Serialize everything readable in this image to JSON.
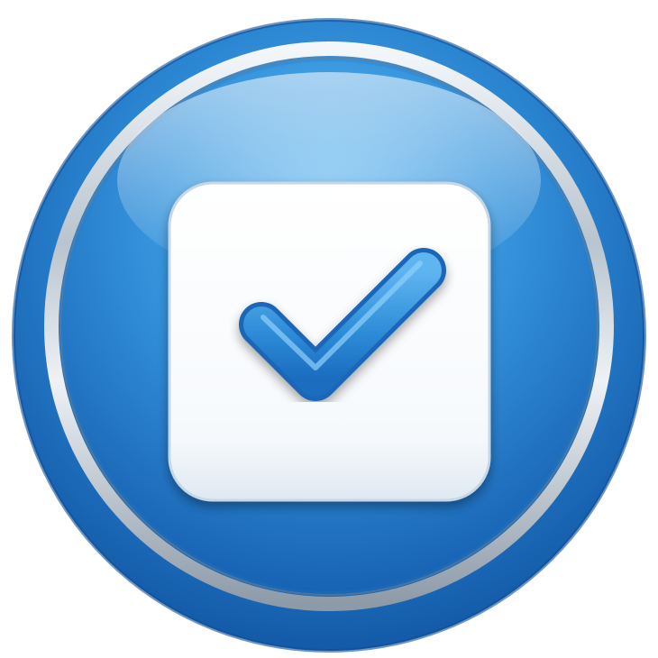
{
  "icon": {
    "name": "checkbox-checked-icon",
    "accent_color": "#2f8fd8",
    "ring_color": "#1c6fc0",
    "bezel_color": "#c9d2da",
    "box_color": "#ffffff",
    "check_color": "#2a88d6"
  }
}
